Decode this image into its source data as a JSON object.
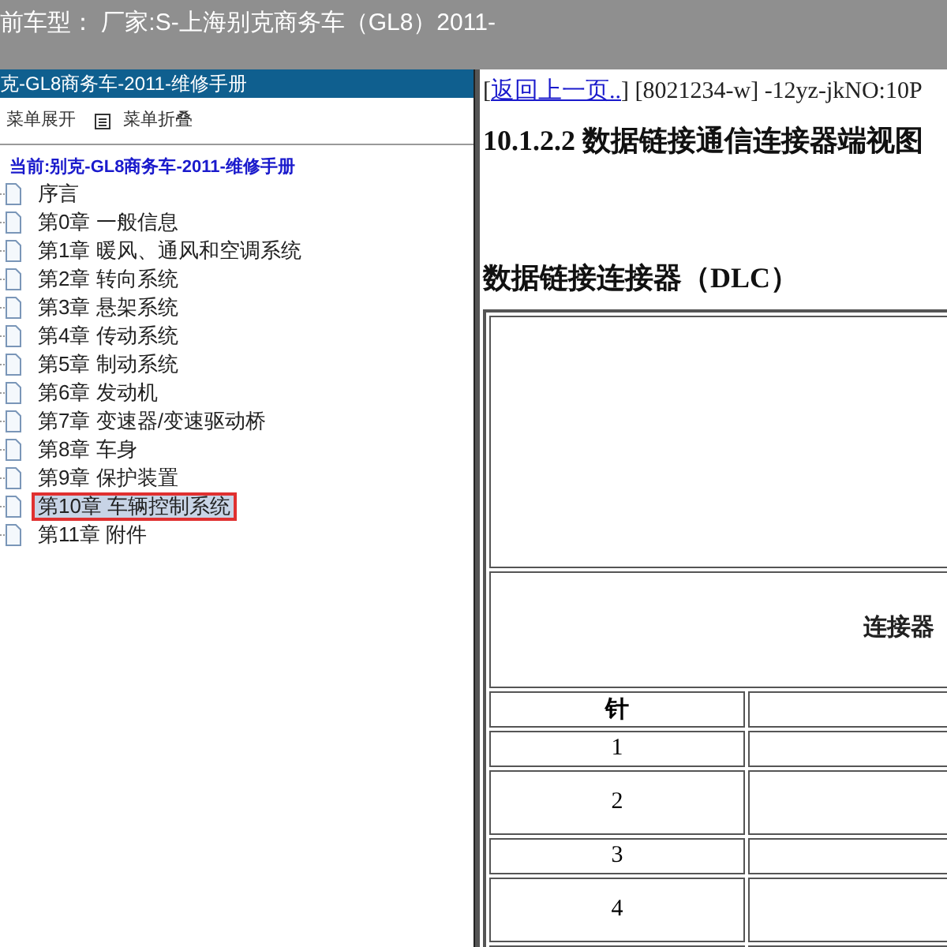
{
  "top_bar": {
    "title": "前车型： 厂家:S-上海别克商务车（GL8）2011-"
  },
  "sidebar": {
    "header": "克-GL8商务车-2011-维修手册",
    "toolbar": [
      {
        "label": "菜单展开",
        "icon": false
      },
      {
        "label": "菜单折叠",
        "icon": true
      }
    ],
    "current": "当前:别克-GL8商务车-2011-维修手册",
    "items": [
      {
        "label": "序言",
        "selected": false
      },
      {
        "label": "第0章 一般信息",
        "selected": false
      },
      {
        "label": "第1章 暖风、通风和空调系统",
        "selected": false
      },
      {
        "label": "第2章 转向系统",
        "selected": false
      },
      {
        "label": "第3章 悬架系统",
        "selected": false
      },
      {
        "label": "第4章 传动系统",
        "selected": false
      },
      {
        "label": "第5章 制动系统",
        "selected": false
      },
      {
        "label": "第6章 发动机",
        "selected": false
      },
      {
        "label": "第7章 变速器/变速驱动桥",
        "selected": false
      },
      {
        "label": "第8章 车身",
        "selected": false
      },
      {
        "label": "第9章 保护装置",
        "selected": false
      },
      {
        "label": "第10章 车辆控制系统",
        "selected": true
      },
      {
        "label": "第11章 附件",
        "selected": false
      }
    ]
  },
  "content": {
    "bracket": "[",
    "back_link": "返回上一页..",
    "doc_code": "] [8021234-w] -12yz-jkNO:10P",
    "title": "10.1.2.2 数据链接通信连接器端视图",
    "section": "数据链接连接器（DLC）",
    "table": {
      "caption": "连接器",
      "columns": [
        "针"
      ],
      "rows": [
        {
          "pin": "1",
          "tall": false
        },
        {
          "pin": "2",
          "tall": true
        },
        {
          "pin": "3",
          "tall": false
        },
        {
          "pin": "4",
          "tall": true
        }
      ]
    }
  }
}
